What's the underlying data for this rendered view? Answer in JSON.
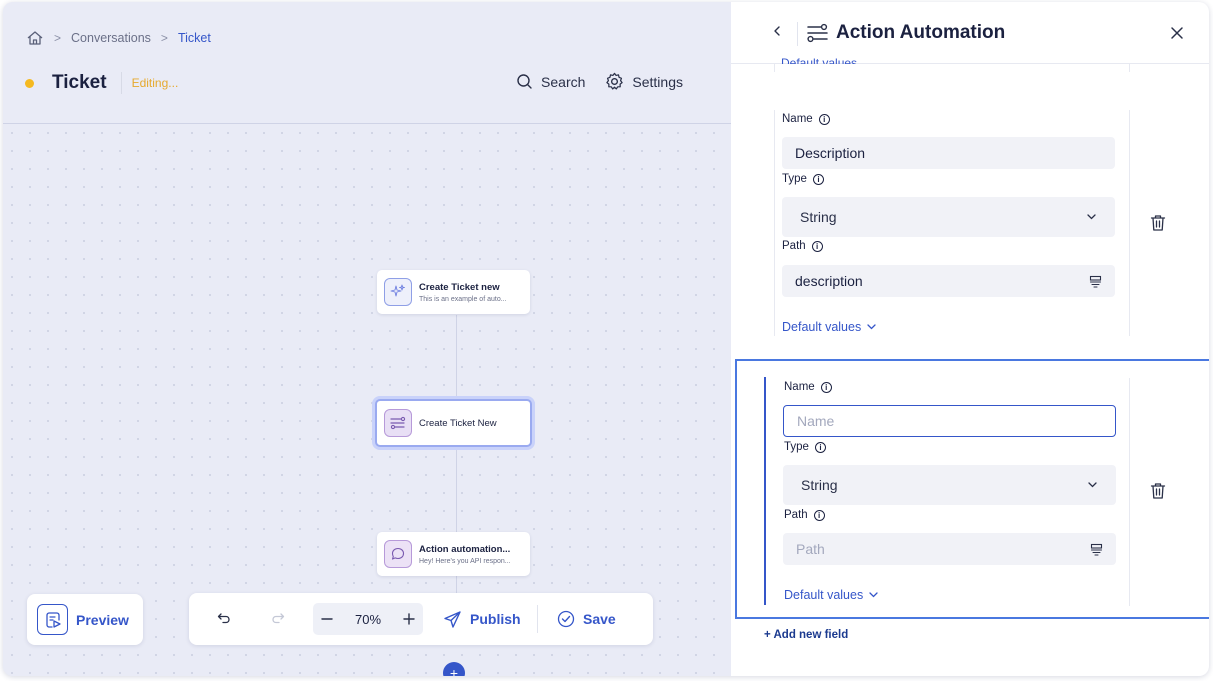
{
  "breadcrumb": {
    "items": [
      "Conversations"
    ],
    "current": "Ticket"
  },
  "header": {
    "title": "Ticket",
    "status": "Editing...",
    "search_label": "Search",
    "settings_label": "Settings"
  },
  "flow": {
    "nodes": [
      {
        "title": "Create Ticket new",
        "subtitle": "This is an example of auto..."
      },
      {
        "title": "Create Ticket New",
        "subtitle": ""
      },
      {
        "title": "Action automation...",
        "subtitle": "Hey! Here's you API respon..."
      }
    ]
  },
  "toolbar": {
    "preview_label": "Preview",
    "zoom": "70%",
    "publish_label": "Publish",
    "save_label": "Save",
    "add_node": "+"
  },
  "panel": {
    "title": "Action Automation",
    "cutoff_link": "Default values",
    "fields": [
      {
        "name_label": "Name",
        "name_value": "Description",
        "name_placeholder": "Name",
        "type_label": "Type",
        "type_value": "String",
        "path_label": "Path",
        "path_value": "description",
        "path_placeholder": "Path",
        "default_values_label": "Default values"
      },
      {
        "name_label": "Name",
        "name_value": "",
        "name_placeholder": "Name",
        "type_label": "Type",
        "type_value": "String",
        "path_label": "Path",
        "path_value": "",
        "path_placeholder": "Path",
        "default_values_label": "Default values"
      }
    ],
    "add_field_label": "+ Add new field"
  },
  "colors": {
    "accent": "#3556c9",
    "status_dot": "#f5b920",
    "editing": "#e6a92d",
    "canvas": "#e9ebf6"
  }
}
